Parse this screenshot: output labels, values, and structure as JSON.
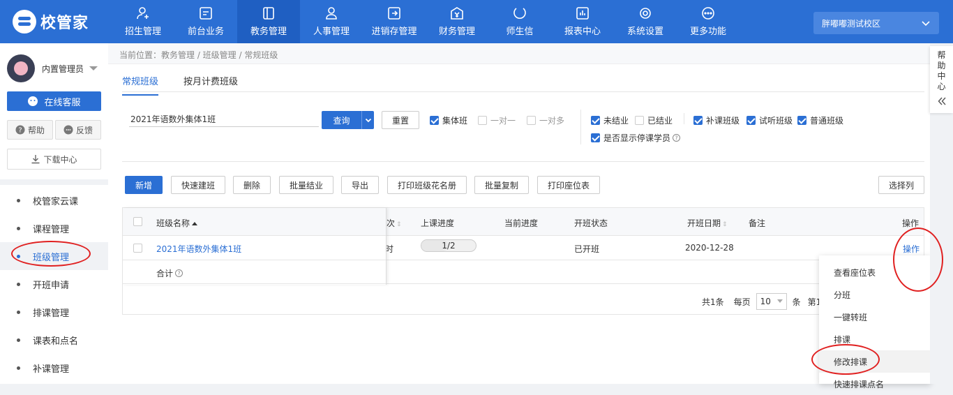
{
  "app": {
    "logo_text": "校管家",
    "campus": "胖嘟嘟测试校区"
  },
  "nav": [
    {
      "label": "招生管理",
      "icon": "user-add-icon"
    },
    {
      "label": "前台业务",
      "icon": "monitor-icon"
    },
    {
      "label": "教务管理",
      "icon": "book-icon",
      "active": true
    },
    {
      "label": "人事管理",
      "icon": "person-icon"
    },
    {
      "label": "进销存管理",
      "icon": "inventory-icon"
    },
    {
      "label": "财务管理",
      "icon": "finance-icon"
    },
    {
      "label": "师生信",
      "icon": "message-icon"
    },
    {
      "label": "报表中心",
      "icon": "report-icon"
    },
    {
      "label": "系统设置",
      "icon": "settings-icon"
    },
    {
      "label": "更多功能",
      "icon": "more-icon"
    }
  ],
  "sidebar": {
    "username": "内置管理员",
    "service_btn": "在线客服",
    "help_btn": "帮助",
    "feedback_btn": "反馈",
    "download_btn": "下载中心",
    "items": [
      "校管家云课",
      "课程管理",
      "班级管理",
      "开班申请",
      "排课管理",
      "课表和点名",
      "补课管理"
    ]
  },
  "breadcrumb": "当前位置：教务管理 / 班级管理 / 常规班级",
  "tabs": [
    "常规班级",
    "按月计费班级"
  ],
  "filters": {
    "search_value": "2021年语数外集体1班",
    "query_btn": "查询",
    "reset_btn": "重置",
    "class_type": [
      {
        "label": "集体班",
        "checked": true
      },
      {
        "label": "一对一",
        "checked": false
      },
      {
        "label": "一对多",
        "checked": false
      }
    ],
    "status": [
      {
        "label": "未结业",
        "checked": true
      },
      {
        "label": "已结业",
        "checked": false
      }
    ],
    "show_stopped": {
      "label": "是否显示停课学员",
      "checked": true
    },
    "kind": [
      {
        "label": "补课班级",
        "checked": true
      },
      {
        "label": "试听班级",
        "checked": true
      },
      {
        "label": "普通班级",
        "checked": true
      }
    ]
  },
  "toolbar": [
    "新增",
    "快速建班",
    "删除",
    "批量结业",
    "导出",
    "打印班级花名册",
    "批量复制",
    "打印座位表"
  ],
  "choose_columns": "选择列",
  "table": {
    "headers": {
      "name": "班级名称",
      "times": "次",
      "progress": "上课进度",
      "current": "当前进度",
      "status": "开班状态",
      "date": "开班日期",
      "remark": "备注",
      "ops": "操作"
    },
    "row": {
      "name": "2021年语数外集体1班",
      "times": "时",
      "progress": "1/2",
      "progress_fraction": 0.5,
      "status": "已开班",
      "date": "2020-12-28",
      "ops": "操作"
    },
    "total_label": "合计"
  },
  "pager": {
    "total": "共1条",
    "per_page_label": "每页",
    "per_page": "10",
    "unit": "条",
    "page_text": "第1"
  },
  "dropdown": [
    "查看座位表",
    "分班",
    "一键转班",
    "排课",
    "修改排课",
    "快速排课点名"
  ],
  "help_panel": [
    "帮",
    "助",
    "中",
    "心"
  ],
  "colors": {
    "brand": "#2b6fd4",
    "annotation": "#e02020"
  }
}
